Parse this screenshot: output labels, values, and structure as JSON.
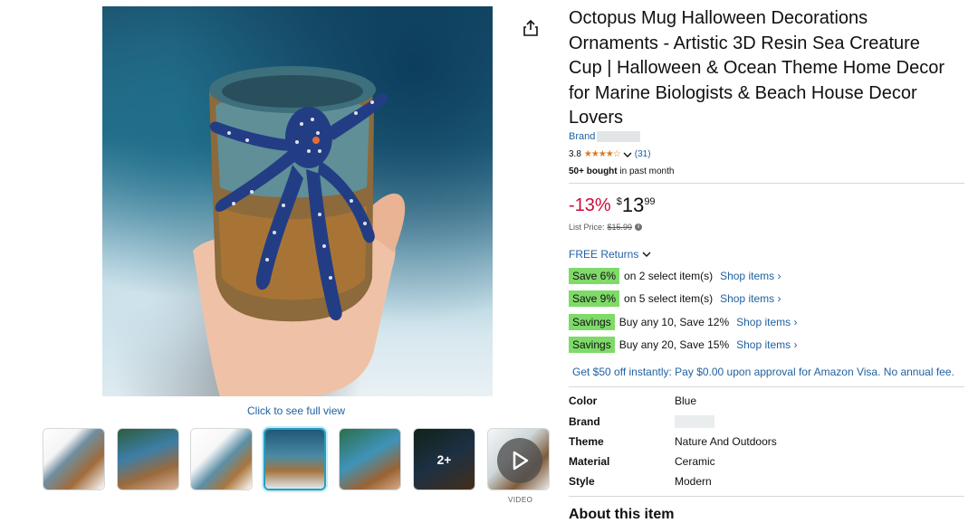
{
  "gallery": {
    "see_full_view": "Click to see full view",
    "thumbnails": [
      {
        "name": "thumbnail-1"
      },
      {
        "name": "thumbnail-2"
      },
      {
        "name": "thumbnail-3"
      },
      {
        "name": "thumbnail-4",
        "selected": true
      },
      {
        "name": "thumbnail-5"
      },
      {
        "name": "thumbnail-6",
        "overlay": "2+"
      },
      {
        "name": "thumbnail-video"
      }
    ],
    "more_count": "2+",
    "video_label": "VIDEO",
    "share_icon": "share-icon",
    "play_icon": "play-icon"
  },
  "product": {
    "title": "Octopus Mug Halloween Decorations Ornaments - Artistic 3D Resin Sea Creature Cup | Halloween & Ocean Theme Home Decor for Marine Biologists & Beach House Decor Lovers",
    "brand_prefix": "Brand",
    "rating": "3.8",
    "stars": "★★★★☆",
    "rating_count": "(31)",
    "bought_bold": "50+ bought",
    "bought_rest": " in past month"
  },
  "price": {
    "discount": "-13%",
    "currency": "$",
    "whole": "13",
    "fraction": "99",
    "list_label": "List Price:",
    "list_value": "$15.99"
  },
  "returns": {
    "label": "FREE Returns"
  },
  "promos": [
    {
      "badge": "Save 6%",
      "text": "on 2 select item(s)",
      "link": "Shop items ›"
    },
    {
      "badge": "Save 9%",
      "text": "on 5 select item(s)",
      "link": "Shop items ›"
    },
    {
      "badge": "Savings",
      "text": "Buy any 10, Save 12%",
      "link": "Shop items ›"
    },
    {
      "badge": "Savings",
      "text": "Buy any 20, Save 15%",
      "link": "Shop items ›"
    }
  ],
  "visa_offer": "Get $50 off instantly: Pay $0.00 upon approval for Amazon Visa. No annual fee.",
  "specs": [
    {
      "key": "Color",
      "value": "Blue"
    },
    {
      "key": "Brand",
      "value": ""
    },
    {
      "key": "Theme",
      "value": "Nature And Outdoors"
    },
    {
      "key": "Material",
      "value": "Ceramic"
    },
    {
      "key": "Style",
      "value": "Modern"
    }
  ],
  "about_heading": "About this item",
  "colors": {
    "link": "#2162a1",
    "discount": "#cc0c39",
    "badge": "#7fda69",
    "star": "#de7921"
  }
}
